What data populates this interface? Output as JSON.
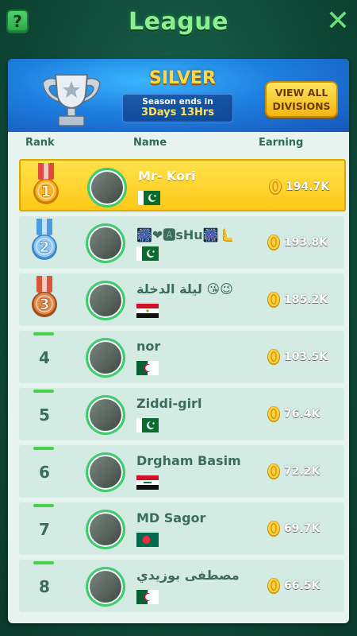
{
  "header": {
    "help_icon": "question-mark-icon",
    "help_label": "?",
    "title": "League",
    "close_icon": "close-x-icon",
    "close_label": "✕"
  },
  "banner": {
    "trophy_icon": "trophy-icon",
    "division": "SILVER",
    "season_label": "Season ends in",
    "season_value": "3Days 13Hrs",
    "view_all_line1": "VIEW ALL",
    "view_all_line2": "DIVISIONS"
  },
  "columns": {
    "rank": "Rank",
    "name": "Name",
    "earning": "Earning"
  },
  "rows": [
    {
      "rank": "1",
      "name": "Mr- Kori",
      "flag": "pakistan",
      "earning": "194.7K",
      "me": true
    },
    {
      "rank": "2",
      "name": "🎆❤🅰sHu🎆🫷",
      "flag": "pakistan",
      "earning": "193.8K"
    },
    {
      "rank": "3",
      "name": "ليلة الدخلة 😘😉",
      "flag": "egypt",
      "earning": "185.2K"
    },
    {
      "rank": "4",
      "name": "nor",
      "flag": "algeria",
      "earning": "103.5K"
    },
    {
      "rank": "5",
      "name": "Ziddi-girl",
      "flag": "pakistan",
      "earning": "76.4K"
    },
    {
      "rank": "6",
      "name": "Drgham Basim",
      "flag": "iraq",
      "earning": "72.2K"
    },
    {
      "rank": "7",
      "name": "MD Sagor",
      "flag": "bangladesh",
      "earning": "69.7K"
    },
    {
      "rank": "8",
      "name": "مصطفى بوزيدي",
      "flag": "algeria",
      "earning": "66.5K"
    }
  ],
  "colors": {
    "gold_medal": "#f2a51a",
    "silver_medal": "#7fb6e6",
    "bronze_medal": "#d77a3a",
    "highlight_row": "#ffd02a",
    "accent_green": "#3ccd6d"
  }
}
